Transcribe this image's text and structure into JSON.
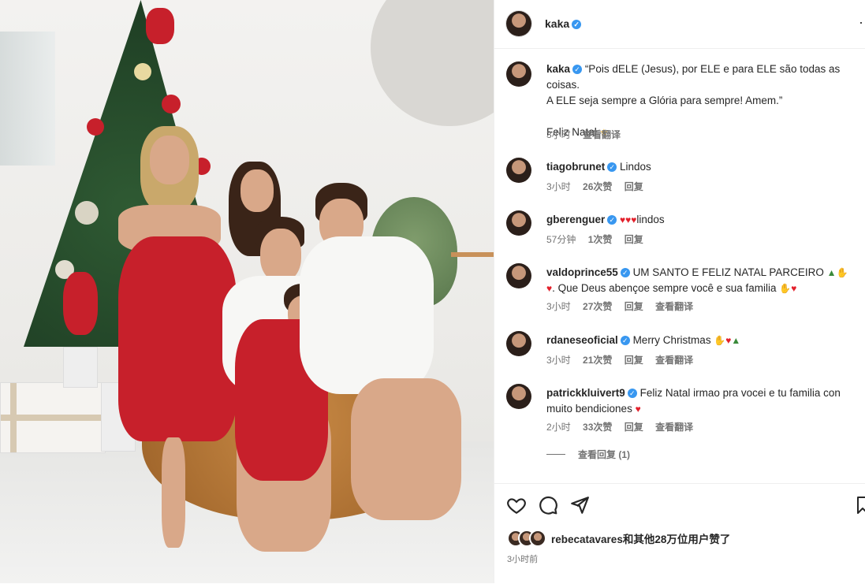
{
  "post": {
    "author": "kaka",
    "caption_lines": [
      "“Pois dELE (Jesus), por ELE e para ELE são todas as coisas.",
      "A ELE seja sempre a Glória para sempre! Amem.”"
    ],
    "caption_line2": "Feliz Natal",
    "caption_time": "3小时",
    "translate": "查看翻译",
    "more_icon": "more-dots-icon"
  },
  "comments": [
    {
      "user": "tiagobrunet",
      "text": "Lindos",
      "time": "3小时",
      "likes": "26次赞",
      "reply": "回复",
      "translate": ""
    },
    {
      "user": "gberenguer",
      "text": "lindos",
      "time": "57分钟",
      "likes": "1次赞",
      "reply": "回复",
      "translate": ""
    },
    {
      "user": "valdoprince55",
      "text": "UM SANTO E FELIZ NATAL PARCEIRO",
      "text2": ". Que Deus abençoe sempre você e sua familia",
      "time": "3小时",
      "likes": "27次赞",
      "reply": "回复",
      "translate": "查看翻译"
    },
    {
      "user": "rdaneseoficial",
      "text": "Merry Christmas",
      "time": "3小时",
      "likes": "21次赞",
      "reply": "回复",
      "translate": "查看翻译"
    },
    {
      "user": "patrickkluivert9",
      "text": "Feliz Natal irmao pra vocei e tu familia con muito bendiciones",
      "time": "2小时",
      "likes": "33次赞",
      "reply": "回复",
      "translate": "查看翻译"
    }
  ],
  "view_replies": "查看回复 (1)",
  "footer": {
    "liked_by": "rebecatavares和其他28万位用户赞了",
    "time": "3小时前"
  },
  "colors": {
    "verified": "#3897f0",
    "heart": "#e3202b",
    "muted": "#737373"
  }
}
